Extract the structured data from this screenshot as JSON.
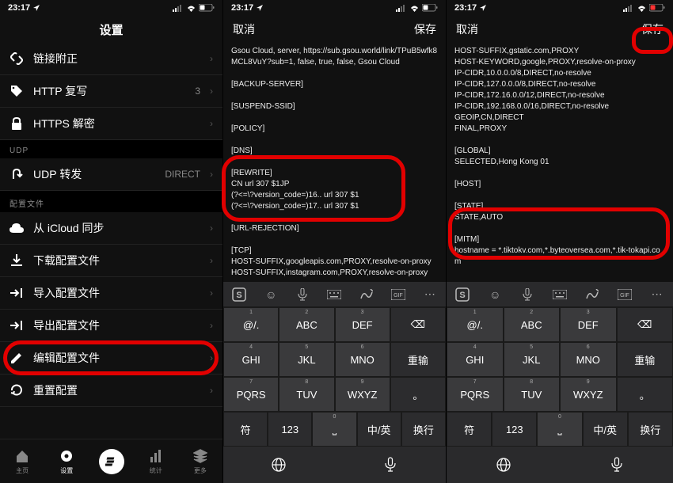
{
  "status": {
    "time": "23:17",
    "loc_arrow": "➤",
    "signal": "ııl",
    "wifi": "wifi",
    "battery": "bat"
  },
  "panel1": {
    "title": "设置",
    "rows": [
      {
        "icon": "link",
        "label": "链接附正"
      },
      {
        "icon": "tag",
        "label": "HTTP 复写",
        "value": "3"
      },
      {
        "icon": "lock",
        "label": "HTTPS 解密"
      }
    ],
    "udp_header": "UDP",
    "udp_row": {
      "icon": "uturn",
      "label": "UDP 转发",
      "value": "DIRECT"
    },
    "cfg_header": "配置文件",
    "cfg_rows": [
      {
        "icon": "cloud",
        "label": "从 iCloud 同步"
      },
      {
        "icon": "download",
        "label": "下载配置文件"
      },
      {
        "icon": "import",
        "label": "导入配置文件"
      },
      {
        "icon": "export",
        "label": "导出配置文件"
      },
      {
        "icon": "edit",
        "label": "编辑配置文件"
      },
      {
        "icon": "reset",
        "label": "重置配置"
      }
    ],
    "tabs": [
      {
        "icon": "home",
        "label": "主页"
      },
      {
        "icon": "gear",
        "label": "设置"
      },
      {
        "icon": "e",
        "label": ""
      },
      {
        "icon": "chart",
        "label": "统计"
      },
      {
        "icon": "layers",
        "label": "更多"
      }
    ]
  },
  "panel2": {
    "cancel": "取消",
    "save": "保存",
    "text": "Gsou Cloud, server, https://sub.gsou.world/link/TPuB5wfk8MCL8VuY?sub=1, false, true, false, Gsou Cloud\n\n[BACKUP-SERVER]\n\n[SUSPEND-SSID]\n\n[POLICY]\n\n[DNS]\n\n[REWRITE]\nCN url 307 $1JP\n(?<=\\?version_code=)16.. url 307 $1\n(?<=\\?version_code=)17.. url 307 $1\n\n[URL-REJECTION]\n\n[TCP]\nHOST-SUFFIX,googleapis.com,PROXY,resolve-on-proxy\nHOST-SUFFIX,instagram.com,PROXY,resolve-on-proxy"
  },
  "panel3": {
    "cancel": "取消",
    "save": "保存",
    "text": "HOST-SUFFIX,gstatic.com,PROXY\nHOST-KEYWORD,google,PROXY,resolve-on-proxy\nIP-CIDR,10.0.0.0/8,DIRECT,no-resolve\nIP-CIDR,127.0.0.0/8,DIRECT,no-resolve\nIP-CIDR,172.16.0.0/12,DIRECT,no-resolve\nIP-CIDR,192.168.0.0/16,DIRECT,no-resolve\nGEOIP,CN,DIRECT\nFINAL,PROXY\n\n[GLOBAL]\nSELECTED,Hong Kong 01\n\n[HOST]\n\n[STATE]\nSTATE,AUTO\n\n[MITM]\nhostname = *.tiktokv.com,*.byteoversea.com,*.tik-tokapi.com"
  },
  "keyboard": {
    "toolbar": [
      "S",
      "☺",
      "mic",
      "kbd",
      "pen",
      "gif",
      "more"
    ],
    "rows": [
      [
        {
          "s": "1",
          "m": "@/."
        },
        {
          "s": "2",
          "m": "ABC"
        },
        {
          "s": "3",
          "m": "DEF"
        },
        {
          "m": "⌫",
          "dark": true
        }
      ],
      [
        {
          "s": "4",
          "m": "GHI"
        },
        {
          "s": "5",
          "m": "JKL"
        },
        {
          "s": "6",
          "m": "MNO"
        },
        {
          "m": "重输",
          "dark": true
        }
      ],
      [
        {
          "s": "7",
          "m": "PQRS"
        },
        {
          "s": "8",
          "m": "TUV"
        },
        {
          "s": "9",
          "m": "WXYZ"
        },
        {
          "m": "。",
          "dark": true
        }
      ],
      [
        {
          "m": "符",
          "dark": true
        },
        {
          "m": "123",
          "dark": true
        },
        {
          "s": "0",
          "m": "⎵"
        },
        {
          "m": "中/英",
          "dark": true
        },
        {
          "m": "换行",
          "dark": true
        }
      ]
    ]
  }
}
